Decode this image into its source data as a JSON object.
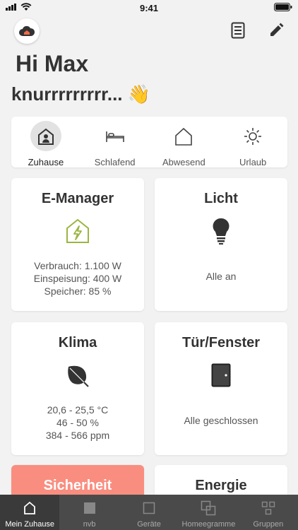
{
  "status_bar": {
    "time": "9:41"
  },
  "greeting": {
    "line1": "Hi Max",
    "line2": "knurrrrrrrrr... 👋"
  },
  "modes": [
    {
      "label": "Zuhause",
      "icon": "home-person-icon",
      "active": true
    },
    {
      "label": "Schlafend",
      "icon": "bed-icon",
      "active": false
    },
    {
      "label": "Abwesend",
      "icon": "house-outline-icon",
      "active": false
    },
    {
      "label": "Urlaub",
      "icon": "sun-icon",
      "active": false
    }
  ],
  "cards": {
    "emanager": {
      "title": "E-Manager",
      "icon": "house-lightning-icon",
      "lines": [
        "Verbrauch: 1.100 W",
        "Einspeisung: 400 W",
        "Speicher: 85 %"
      ]
    },
    "licht": {
      "title": "Licht",
      "icon": "bulb-icon",
      "status": "Alle an"
    },
    "klima": {
      "title": "Klima",
      "icon": "leaf-icon",
      "lines": [
        "20,6 - 25,5 °C",
        "46 - 50 %",
        "384 - 566 ppm"
      ]
    },
    "tuer": {
      "title": "Tür/Fenster",
      "icon": "door-icon",
      "status": "Alle geschlossen"
    },
    "sicherheit": {
      "title": "Sicherheit"
    },
    "energie": {
      "title": "Energie"
    }
  },
  "tabs": [
    {
      "label": "Mein Zuhause",
      "icon": "home-icon",
      "active": true
    },
    {
      "label": "nvb",
      "icon": "square-filled-icon",
      "active": false
    },
    {
      "label": "Geräte",
      "icon": "square-outline-icon",
      "active": false
    },
    {
      "label": "Homeegramme",
      "icon": "overlap-squares-icon",
      "active": false
    },
    {
      "label": "Gruppen",
      "icon": "grid-icon",
      "active": false
    }
  ],
  "colors": {
    "alert": "#f98e80",
    "accent_green": "#9ab541",
    "tabbar": "#4a4a4a"
  }
}
